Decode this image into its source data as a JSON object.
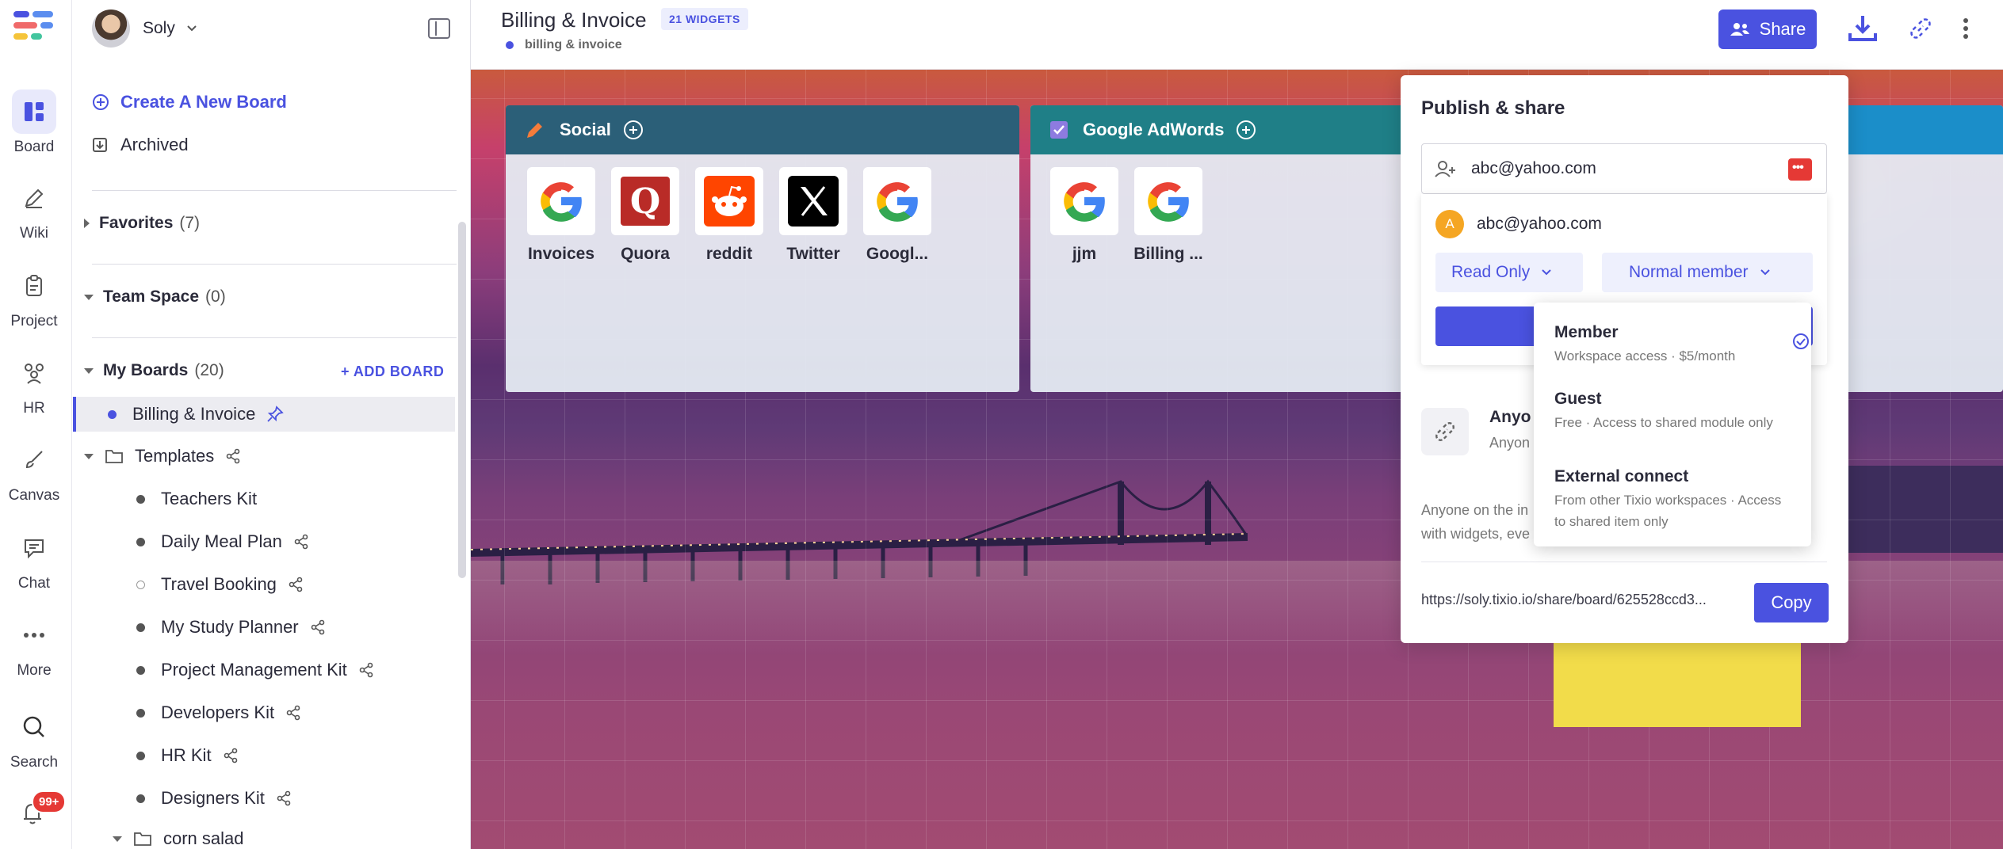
{
  "rail": {
    "items": [
      {
        "label": "Board",
        "icon": "board-icon",
        "active": true
      },
      {
        "label": "Wiki",
        "icon": "pencil-icon"
      },
      {
        "label": "Project",
        "icon": "clipboard-icon"
      },
      {
        "label": "HR",
        "icon": "people-icon"
      },
      {
        "label": "Canvas",
        "icon": "brush-icon"
      },
      {
        "label": "Chat",
        "icon": "chat-icon"
      },
      {
        "label": "More",
        "icon": "more-icon"
      },
      {
        "label": "Search",
        "icon": "search-icon"
      }
    ],
    "notifications_badge": "99+"
  },
  "sidebar": {
    "user_name": "Soly",
    "create_board": "Create A New Board",
    "archived": "Archived",
    "favorites": {
      "label": "Favorites",
      "count": "(7)"
    },
    "team_space": {
      "label": "Team Space",
      "count": "(0)"
    },
    "my_boards": {
      "label": "My Boards",
      "count": "(20)",
      "add_label": "+ ADD BOARD"
    },
    "selected_board": "Billing & Invoice",
    "templates_label": "Templates",
    "templates": [
      {
        "label": "Teachers Kit",
        "shared": false
      },
      {
        "label": "Daily Meal Plan",
        "shared": true
      },
      {
        "label": "Travel Booking",
        "shared": true
      },
      {
        "label": "My Study Planner",
        "shared": true
      },
      {
        "label": "Project Management Kit",
        "shared": true
      },
      {
        "label": "Developers Kit",
        "shared": true
      },
      {
        "label": "HR Kit",
        "shared": true
      },
      {
        "label": "Designers Kit",
        "shared": true
      }
    ],
    "corn_salad": "corn salad"
  },
  "topbar": {
    "title": "Billing & Invoice",
    "widgets_count": "21 WIDGETS",
    "breadcrumb": "billing & invoice",
    "share_label": "Share"
  },
  "widgets": {
    "social": {
      "title": "Social",
      "apps": [
        {
          "label": "Invoices",
          "icon": "google-icon"
        },
        {
          "label": "Quora",
          "icon": "quora-icon"
        },
        {
          "label": "reddit",
          "icon": "reddit-icon"
        },
        {
          "label": "Twitter",
          "icon": "x-icon"
        },
        {
          "label": "Googl...",
          "icon": "google-icon"
        }
      ]
    },
    "adwords": {
      "title": "Google AdWords",
      "apps": [
        {
          "label": "jjm",
          "icon": "google-icon"
        },
        {
          "label": "Billing ...",
          "icon": "google-icon"
        }
      ]
    }
  },
  "share_panel": {
    "title": "Publish & share",
    "email_value": "abc@yahoo.com",
    "suggestion_email": "abc@yahoo.com",
    "suggestion_avatar": "A",
    "permission": "Read Only",
    "member_type": "Normal member",
    "anyone_title": "Anyo",
    "anyone_sub": "Anyon",
    "anyone_desc_1": "Anyone on the in",
    "anyone_desc_2": "with widgets, eve",
    "share_link": "https://soly.tixio.io/share/board/625528ccd3...",
    "copy_label": "Copy"
  },
  "role_menu": [
    {
      "name": "Member",
      "desc": "Workspace access · $5/month",
      "selected": true
    },
    {
      "name": "Guest",
      "desc": "Free · Access to shared module only",
      "selected": false
    },
    {
      "name": "External connect",
      "desc": "From other Tixio workspaces · Access to shared item only",
      "selected": false
    }
  ],
  "colors": {
    "accent": "#4a52e0",
    "social_header": "#2b5f78",
    "adwords_header": "#1f7f87",
    "badge": "#e53935"
  }
}
